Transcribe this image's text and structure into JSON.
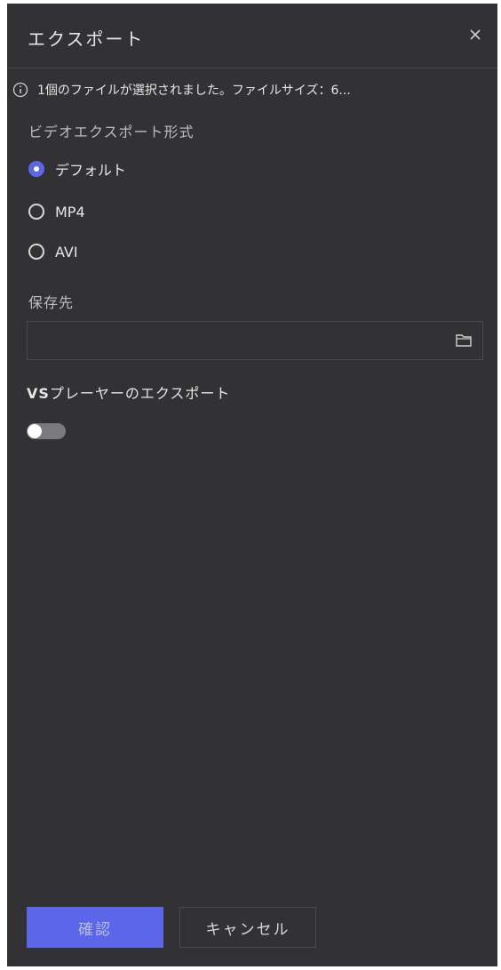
{
  "dialog": {
    "title": "エクスポート"
  },
  "info": {
    "message": "1個のファイルが選択されました。ファイルサイズ：6..."
  },
  "format": {
    "label": "ビデオエクスポート形式",
    "options": [
      {
        "label": "デフォルト",
        "selected": true
      },
      {
        "label": "MP4",
        "selected": false
      },
      {
        "label": "AVI",
        "selected": false
      }
    ]
  },
  "save": {
    "label": "保存先",
    "value": "",
    "placeholder": ""
  },
  "vs_export": {
    "label_prefix": "VS",
    "label_suffix": "プレーヤーのエクスポート",
    "enabled": false
  },
  "footer": {
    "confirm_label": "確認",
    "cancel_label": "キャンセル"
  },
  "colors": {
    "panel_bg": "#323134",
    "accent": "#5b66e8",
    "text": "#e6e6e6",
    "muted": "#bdbdbd",
    "border": "#4a494c"
  },
  "icons": {
    "close": "close-icon",
    "info": "info-icon",
    "folder": "folder-icon"
  }
}
